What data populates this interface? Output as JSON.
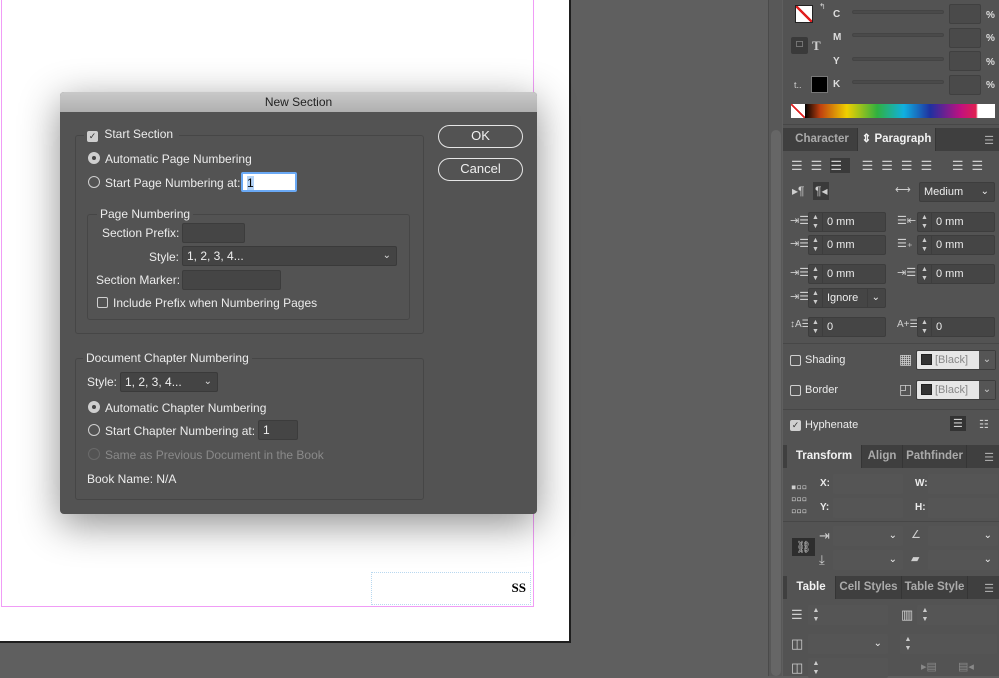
{
  "document": {
    "footer_text": "SS"
  },
  "dialog": {
    "title": "New Section",
    "start_section": {
      "label": "Start Section",
      "checked": true
    },
    "automatic_page_numbering": {
      "label": "Automatic Page Numbering",
      "selected": true
    },
    "start_page_numbering": {
      "label": "Start Page Numbering at:",
      "value": "1",
      "selected": false
    },
    "page_numbering": {
      "legend": "Page Numbering",
      "section_prefix_label": "Section Prefix:",
      "section_prefix_value": "",
      "style_label": "Style:",
      "style_value": "1, 2, 3, 4...",
      "section_marker_label": "Section Marker:",
      "section_marker_value": "",
      "include_prefix_label": "Include Prefix when Numbering Pages",
      "include_prefix_checked": false
    },
    "chapter": {
      "legend": "Document Chapter Numbering",
      "style_label": "Style:",
      "style_value": "1, 2, 3, 4...",
      "automatic_label": "Automatic Chapter Numbering",
      "automatic_selected": true,
      "start_label": "Start Chapter Numbering at:",
      "start_value": "1",
      "same_as_previous_label": "Same as Previous Document in the Book",
      "book_name": "Book Name: N/A"
    },
    "ok_label": "OK",
    "cancel_label": "Cancel"
  },
  "color_panel": {
    "channels": [
      {
        "label": "C",
        "unit": "%"
      },
      {
        "label": "M",
        "unit": "%"
      },
      {
        "label": "Y",
        "unit": "%"
      },
      {
        "label": "K",
        "unit": "%"
      }
    ],
    "text_icon": "T",
    "tint_label": "t.."
  },
  "paragraph_panel": {
    "tabs": [
      {
        "label": "Character",
        "active": false
      },
      {
        "label": "Paragraph",
        "active": true
      }
    ],
    "composer": "Medium",
    "left_indent": "0 mm",
    "right_indent": "0 mm",
    "first_line_indent": "0 mm",
    "last_line_indent": "0 mm",
    "space_before": "0 mm",
    "space_after": "0 mm",
    "align_to_grid": "Ignore",
    "drop_cap_lines": "0",
    "drop_cap_chars": "0",
    "shading": {
      "label": "Shading",
      "checked": false,
      "color": "[Black]"
    },
    "border": {
      "label": "Border",
      "checked": false,
      "color": "[Black]"
    },
    "hyphenate": {
      "label": "Hyphenate",
      "checked": true
    }
  },
  "transform_panel": {
    "tabs": [
      {
        "label": "Transform",
        "active": true
      },
      {
        "label": "Align",
        "active": false
      },
      {
        "label": "Pathfinder",
        "active": false
      }
    ],
    "x_label": "X:",
    "y_label": "Y:",
    "w_label": "W:",
    "h_label": "H:"
  },
  "table_panel": {
    "tabs": [
      {
        "label": "Table",
        "active": true
      },
      {
        "label": "Cell Styles",
        "active": false
      },
      {
        "label": "Table Style",
        "active": false
      }
    ]
  },
  "colors": {
    "accent_field_border": "#6aa9f5",
    "margin_guide": "#f09cf6"
  }
}
